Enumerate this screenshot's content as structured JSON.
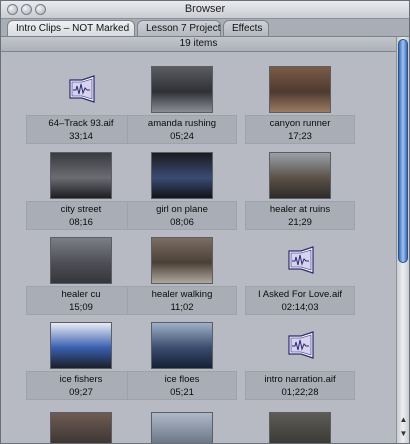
{
  "window": {
    "title": "Browser"
  },
  "tabs": [
    {
      "label": "Intro Clips – NOT Marked",
      "active": true
    },
    {
      "label": "Lesson 7 Project",
      "active": false
    },
    {
      "label": "Effects",
      "active": false
    }
  ],
  "item_count": "19 items",
  "items": [
    {
      "name": "64–Track 93.aif",
      "duration": "33;14",
      "kind": "audio"
    },
    {
      "name": "amanda rushing",
      "duration": "05;24",
      "kind": "video",
      "scene": [
        "#5a5c60",
        "#2f3137",
        "#8b8d95"
      ]
    },
    {
      "name": "canyon runner",
      "duration": "17;23",
      "kind": "video",
      "scene": [
        "#7b5b47",
        "#4e3a30",
        "#9b7b63"
      ]
    },
    {
      "name": "city street",
      "duration": "08;16",
      "kind": "video",
      "scene": [
        "#3a3b40",
        "#6a6c72",
        "#1d1e22"
      ]
    },
    {
      "name": "girl on plane",
      "duration": "08;06",
      "kind": "video",
      "scene": [
        "#1a1b1f",
        "#3b4b73",
        "#11131a"
      ]
    },
    {
      "name": "healer at ruins",
      "duration": "21;29",
      "kind": "video",
      "scene": [
        "#9aa0a8",
        "#5b5248",
        "#2c2a29"
      ]
    },
    {
      "name": "healer cu",
      "duration": "15;09",
      "kind": "video",
      "scene": [
        "#7b7f88",
        "#4e4f55",
        "#35363b"
      ]
    },
    {
      "name": "healer walking",
      "duration": "11;02",
      "kind": "video",
      "scene": [
        "#7b6e63",
        "#4a4036",
        "#b0a89e"
      ]
    },
    {
      "name": "I Asked For Love.aif",
      "duration": "02:14;03",
      "kind": "audio"
    },
    {
      "name": "ice fishers",
      "duration": "09;27",
      "kind": "video",
      "scene": [
        "#e7ecf4",
        "#3a5fb0",
        "#1b1f2a"
      ]
    },
    {
      "name": "ice floes",
      "duration": "05;21",
      "kind": "video",
      "scene": [
        "#9fb1c7",
        "#3a4d6e",
        "#142035"
      ]
    },
    {
      "name": "intro narration.aif",
      "duration": "01;22;28",
      "kind": "audio"
    }
  ],
  "partial_row_colors": [
    [
      "#6d5c54",
      "#3d3532"
    ],
    [
      "#aeb8c8",
      "#6a7586"
    ],
    [
      "#5e5c55",
      "#3b3935"
    ]
  ],
  "icons": {
    "close": "close-icon",
    "minimize": "minimize-icon",
    "zoom": "zoom-icon",
    "audio": "speaker-waveform-icon",
    "scroll_up": "scroll-up-arrow-icon",
    "scroll_down": "scroll-down-arrow-icon"
  }
}
